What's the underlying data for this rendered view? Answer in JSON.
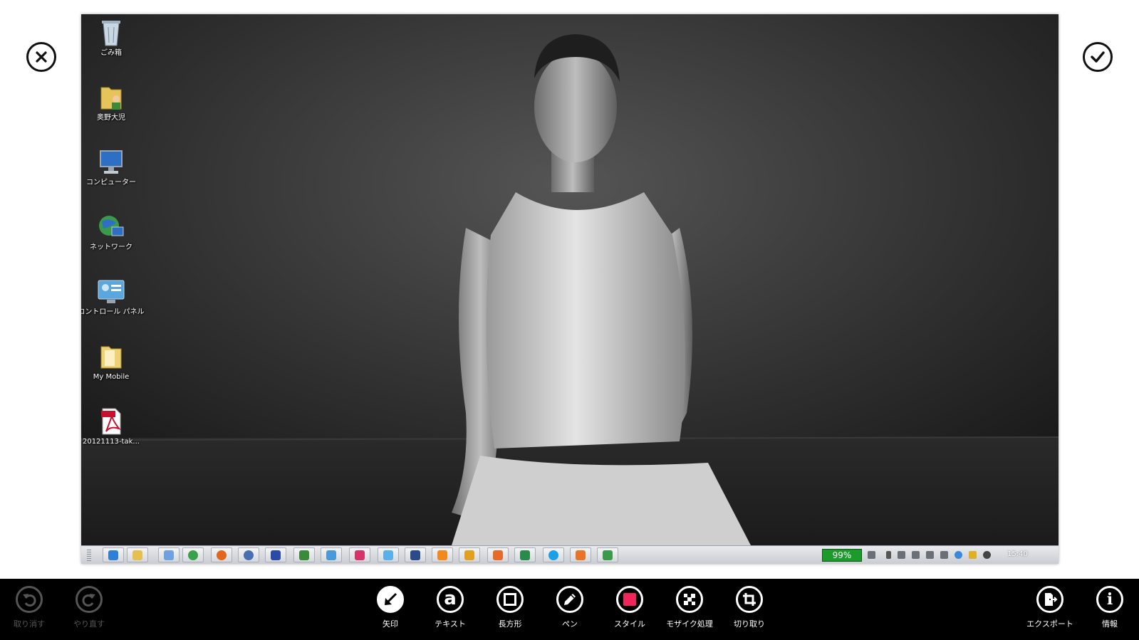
{
  "corner_buttons": {
    "cancel_icon": "close-icon",
    "confirm_icon": "checkmark-icon"
  },
  "desktop": {
    "icons": [
      {
        "label": "ごみ箱",
        "icon": "recycle-bin-icon"
      },
      {
        "label": "奥野大児",
        "icon": "user-folder-icon"
      },
      {
        "label": "コンピューター",
        "icon": "computer-icon"
      },
      {
        "label": "ネットワーク",
        "icon": "network-icon"
      },
      {
        "label": "コントロール パネル",
        "icon": "control-panel-icon"
      },
      {
        "label": "My Mobile",
        "icon": "folder-icon"
      },
      {
        "label": "20121113-tak...",
        "icon": "pdf-file-icon"
      }
    ]
  },
  "taskbar": {
    "battery": "99%",
    "clock": "15:40"
  },
  "appbar": {
    "left": [
      {
        "label": "取り消す",
        "icon": "undo-icon",
        "enabled": false
      },
      {
        "label": "やり直す",
        "icon": "redo-icon",
        "enabled": false
      }
    ],
    "tools": [
      {
        "label": "矢印",
        "icon": "arrow-icon",
        "active": true
      },
      {
        "label": "テキスト",
        "icon": "text-icon"
      },
      {
        "label": "長方形",
        "icon": "rectangle-icon"
      },
      {
        "label": "ペン",
        "icon": "pen-icon"
      },
      {
        "label": "スタイル",
        "icon": "style-swatch-icon",
        "color": "#f0265a"
      },
      {
        "label": "モザイク処理",
        "icon": "mosaic-icon"
      },
      {
        "label": "切り取り",
        "icon": "crop-icon"
      }
    ],
    "right": [
      {
        "label": "エクスポート",
        "icon": "export-icon"
      },
      {
        "label": "情報",
        "icon": "info-icon"
      }
    ]
  }
}
